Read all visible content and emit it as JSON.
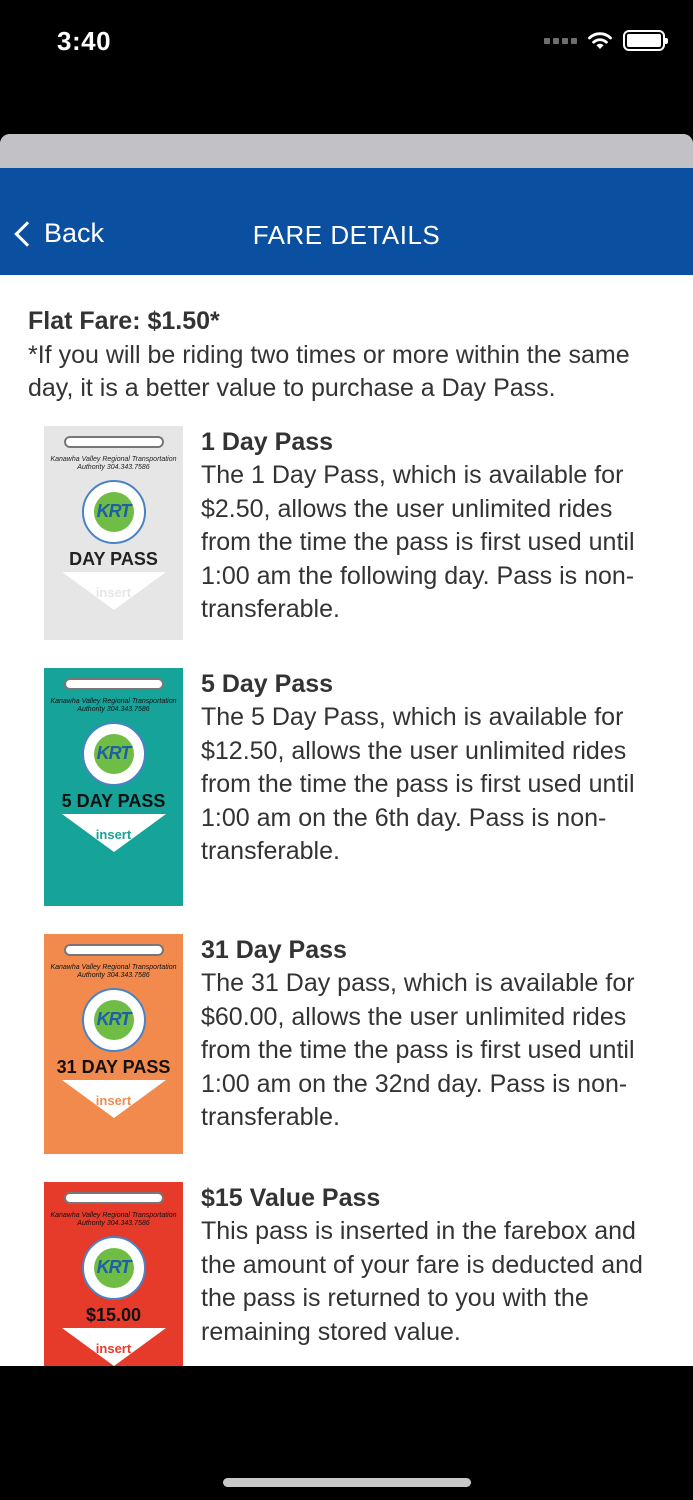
{
  "status_bar": {
    "time": "3:40"
  },
  "nav": {
    "back_label": "Back",
    "title": "FARE DETAILS"
  },
  "intro": {
    "flat_fare": "Flat Fare: $1.50*",
    "note": "*If you will be riding two times or more within the same day, it is a better value to purchase a Day Pass."
  },
  "card_common": {
    "agency": "Kanawha Valley Regional Transportation Authority 304.343.7586",
    "logo": "KRT",
    "insert": "insert"
  },
  "passes": [
    {
      "title": "1 Day Pass",
      "description": "The 1 Day Pass, which is available for $2.50, allows the user unlimited rides from the time the pass is first used until 1:00 am the following day. Pass is non-transferable.",
      "card_label": "DAY PASS",
      "card_color": "#e6e6e6",
      "card_text_color": "#222222"
    },
    {
      "title": "5 Day Pass",
      "description": "The 5 Day Pass, which is available for $12.50, allows the user unlimited rides from the time the pass is first used until 1:00 am on the 6th day. Pass is non-transferable.",
      "card_label": "5 DAY PASS",
      "card_color": "#15a39a",
      "card_text_color": "#111111"
    },
    {
      "title": "31 Day Pass",
      "description": "The 31 Day pass, which is available for $60.00, allows the user unlimited rides from the time the pass is first used until 1:00 am on the 32nd day. Pass is non-transferable.",
      "card_label": "31 DAY PASS",
      "card_color": "#f28a4e",
      "card_text_color": "#111111"
    },
    {
      "title": "$15 Value Pass",
      "description": "This pass is inserted in the farebox and the amount of your fare is deducted and the pass is returned to you with the remaining stored value.",
      "card_label": "$15.00",
      "card_color": "#e63a2a",
      "card_text_color": "#111111"
    }
  ]
}
